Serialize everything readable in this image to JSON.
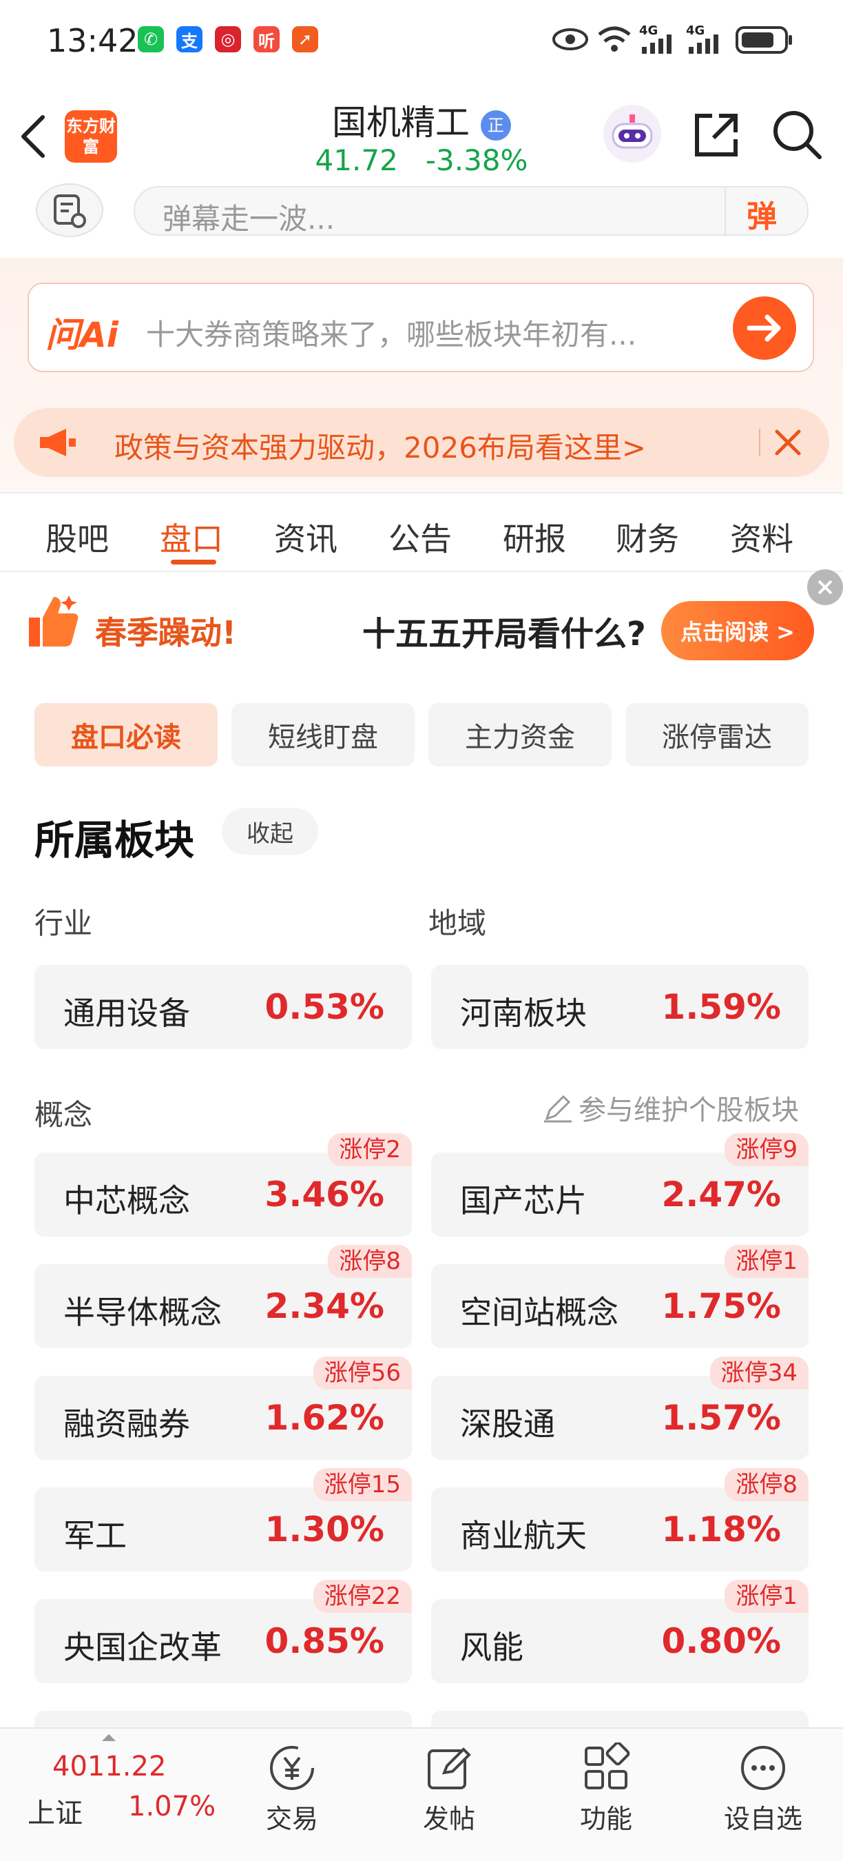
{
  "status_bar": {
    "time": "13:42",
    "network": "4G",
    "network2": "4G"
  },
  "header": {
    "logo_text": "东方财富",
    "title": "国机精工",
    "badge": "正",
    "price": "41.72",
    "change": "-3.38%"
  },
  "danmu": {
    "placeholder": "弹幕走一波...",
    "button": "弹"
  },
  "ai": {
    "logo": "问Ai",
    "prompt": "十大券商策略来了，哪些板块年初有..."
  },
  "banner": {
    "text": "政策与资本强力驱动，2026布局看这里>"
  },
  "tabs": [
    "股吧",
    "盘口",
    "资讯",
    "公告",
    "研报",
    "财务",
    "资料"
  ],
  "promo": {
    "left": "春季躁动!",
    "center": "十五五开局看什么?",
    "button": "点击阅读 >"
  },
  "chips": [
    "盘口必读",
    "短线盯盘",
    "主力资金",
    "涨停雷达"
  ],
  "section": {
    "title": "所属板块",
    "collapse": "收起"
  },
  "industry": {
    "label": "行业",
    "name": "通用设备",
    "pct": "0.53%"
  },
  "region": {
    "label": "地域",
    "name": "河南板块",
    "pct": "1.59%"
  },
  "concept": {
    "label": "概念",
    "edit": "参与维护个股板块",
    "items": [
      {
        "name": "中芯概念",
        "pct": "3.46%",
        "badge": "涨停2"
      },
      {
        "name": "国产芯片",
        "pct": "2.47%",
        "badge": "涨停9"
      },
      {
        "name": "半导体概念",
        "pct": "2.34%",
        "badge": "涨停8"
      },
      {
        "name": "空间站概念",
        "pct": "1.75%",
        "badge": "涨停1"
      },
      {
        "name": "融资融券",
        "pct": "1.62%",
        "badge": "涨停56"
      },
      {
        "name": "深股通",
        "pct": "1.57%",
        "badge": "涨停34"
      },
      {
        "name": "军工",
        "pct": "1.30%",
        "badge": "涨停15"
      },
      {
        "name": "商业航天",
        "pct": "1.18%",
        "badge": "涨停8"
      },
      {
        "name": "央国企改革",
        "pct": "0.85%",
        "badge": "涨停22"
      },
      {
        "name": "风能",
        "pct": "0.80%",
        "badge": "涨停1"
      }
    ]
  },
  "bottom": {
    "index_value": "4011.22",
    "index_name": "上证",
    "index_pct": "1.07%",
    "items": [
      "交易",
      "发帖",
      "功能",
      "设自选"
    ]
  },
  "colors": {
    "accent": "#e8551b",
    "up": "#e0292b",
    "down": "#15a34a"
  }
}
